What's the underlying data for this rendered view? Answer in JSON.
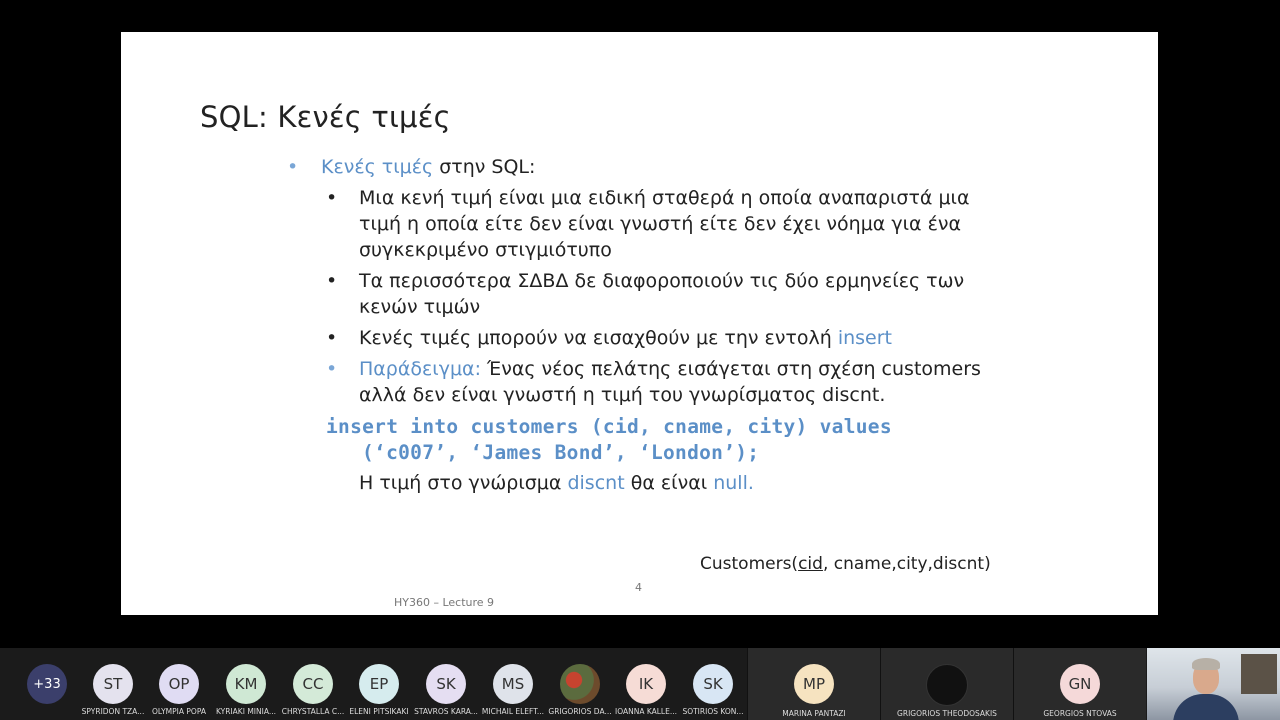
{
  "slide": {
    "title": "SQL: Κενές τιμές",
    "bullet_main_highlight": "Κενές τιμές",
    "bullet_main_rest": " στην SQL:",
    "sub1_lines": [
      "Μια κενή τιμή είναι μια ειδική σταθερά η οποία αναπαριστά μια",
      "τιμή η οποία είτε δεν είναι γνωστή είτε δεν έχει νόημα για ένα",
      "συγκεκριμένο στιγμιότυπο"
    ],
    "sub2_lines": [
      "Τα περισσότερα ΣΔΒΔ δε διαφοροποιούν τις δύο ερμηνείες των",
      "κενών τιμών"
    ],
    "sub3_text": "Κενές τιμές μπορούν να εισαχθούν με την εντολή ",
    "sub3_highlight": "insert",
    "sub4_highlight": "Παράδειγμα:",
    "sub4_line1": " Ένας νέος πελάτης εισάγεται στη σχέση customers",
    "sub4_line2": "αλλά δεν είναι γνωστή η τιμή του γνωρίσματος discnt.",
    "code_line1": "insert into customers (cid, cname, city) values",
    "code_line2": "(‘c007’, ‘James Bond’, ‘London’);",
    "result_text1": "Η τιμή στο γνώρισμα ",
    "result_hl1": "discnt",
    "result_text2": " θα είναι ",
    "result_hl2": "null.",
    "schema_prefix": "Customers(",
    "schema_key": "cid",
    "schema_rest": ", cname,city,discnt)",
    "page_number": "4",
    "footer": "HY360 – Lecture 9"
  },
  "participants": {
    "more_count": "+33",
    "list": [
      {
        "initials": "ST",
        "name": "SPYRIDON TZA...",
        "color": "#e4e2ee"
      },
      {
        "initials": "OP",
        "name": "OLYMPIA POPA",
        "color": "#e0dcf3"
      },
      {
        "initials": "KM",
        "name": "KYRIAKI MINIA...",
        "color": "#cfe8d4"
      },
      {
        "initials": "CC",
        "name": "CHRYSTALLA C...",
        "color": "#d4ead8"
      },
      {
        "initials": "EP",
        "name": "ELENI PITSIKAKI",
        "color": "#d6ecee"
      },
      {
        "initials": "SK",
        "name": "STAVROS KARA...",
        "color": "#e5def2"
      },
      {
        "initials": "MS",
        "name": "MICHAIL ELEFT...",
        "color": "#dfe3ea"
      },
      {
        "initials": "",
        "name": "GRIGORIOS DA...",
        "color": "#7a5b3a"
      },
      {
        "initials": "IK",
        "name": "IOANNA KALLE...",
        "color": "#f6dcd6"
      },
      {
        "initials": "SK",
        "name": "SOTIRIOS KON...",
        "color": "#d8e6f4"
      }
    ],
    "featured": [
      {
        "initials": "MP",
        "name": "MARINA PANTAZI",
        "color": "#f6e3c0"
      },
      {
        "initials": "",
        "name": "GRIGORIOS THEODOSAKIS",
        "color": "#111111"
      },
      {
        "initials": "GN",
        "name": "GEORGIOS NTOVAS",
        "color": "#f5d9d9"
      }
    ]
  }
}
